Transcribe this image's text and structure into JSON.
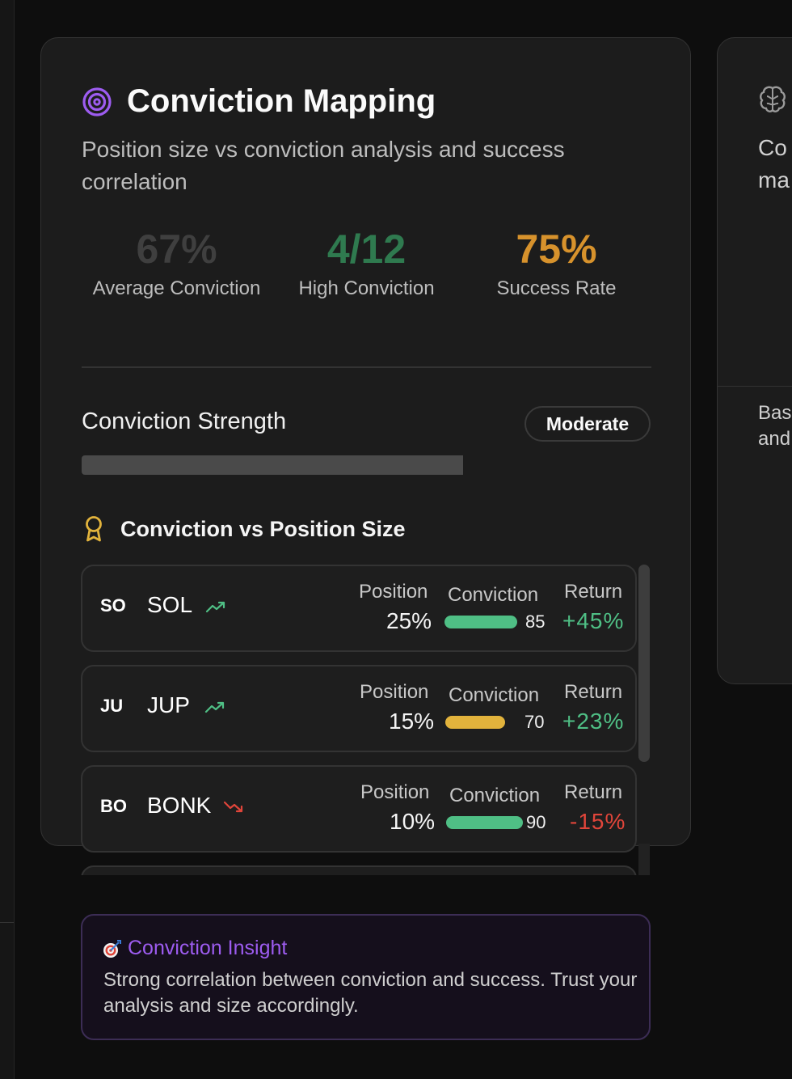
{
  "card": {
    "title": "Conviction Mapping",
    "subtitle": "Position size vs conviction analysis and success correlation",
    "stats": [
      {
        "value": "67%",
        "label": "Average Conviction",
        "color": "#3f3f3f"
      },
      {
        "value": "4/12",
        "label": "High Conviction",
        "color": "#2f7a4f"
      },
      {
        "value": "75%",
        "label": "Success Rate",
        "color": "#d7922c"
      }
    ],
    "strength": {
      "label": "Conviction Strength",
      "badge": "Moderate",
      "level_percent": 67
    },
    "section_title": "Conviction vs Position Size",
    "headers": {
      "position": "Position",
      "conviction": "Conviction",
      "return": "Return"
    },
    "positions": [
      {
        "symbol": "SO",
        "name": "SOL",
        "trend": "trending-up",
        "position": "25%",
        "conviction": 85,
        "conviction_color": "#4fbf85",
        "return": "+45%",
        "return_color": "#4fbf85"
      },
      {
        "symbol": "JU",
        "name": "JUP",
        "trend": "trending-up",
        "position": "15%",
        "conviction": 70,
        "conviction_color": "#e2b33c",
        "return": "+23%",
        "return_color": "#4fbf85"
      },
      {
        "symbol": "BO",
        "name": "BONK",
        "trend": "trending-down",
        "position": "10%",
        "conviction": 90,
        "conviction_color": "#4fbf85",
        "return": "-15%",
        "return_color": "#e0453a"
      }
    ]
  },
  "side_card": {
    "title_fragment_1": "Co",
    "title_fragment_2": "ma",
    "body_fragment_1": "Bas",
    "body_fragment_2": "and"
  },
  "insight": {
    "title": "Conviction Insight",
    "text": "Strong correlation between conviction and success. Trust your analysis and size accordingly."
  },
  "colors": {
    "accent_purple": "#9d5cf0",
    "gold": "#e2b33c",
    "green": "#4fbf85",
    "red": "#e0453a"
  }
}
